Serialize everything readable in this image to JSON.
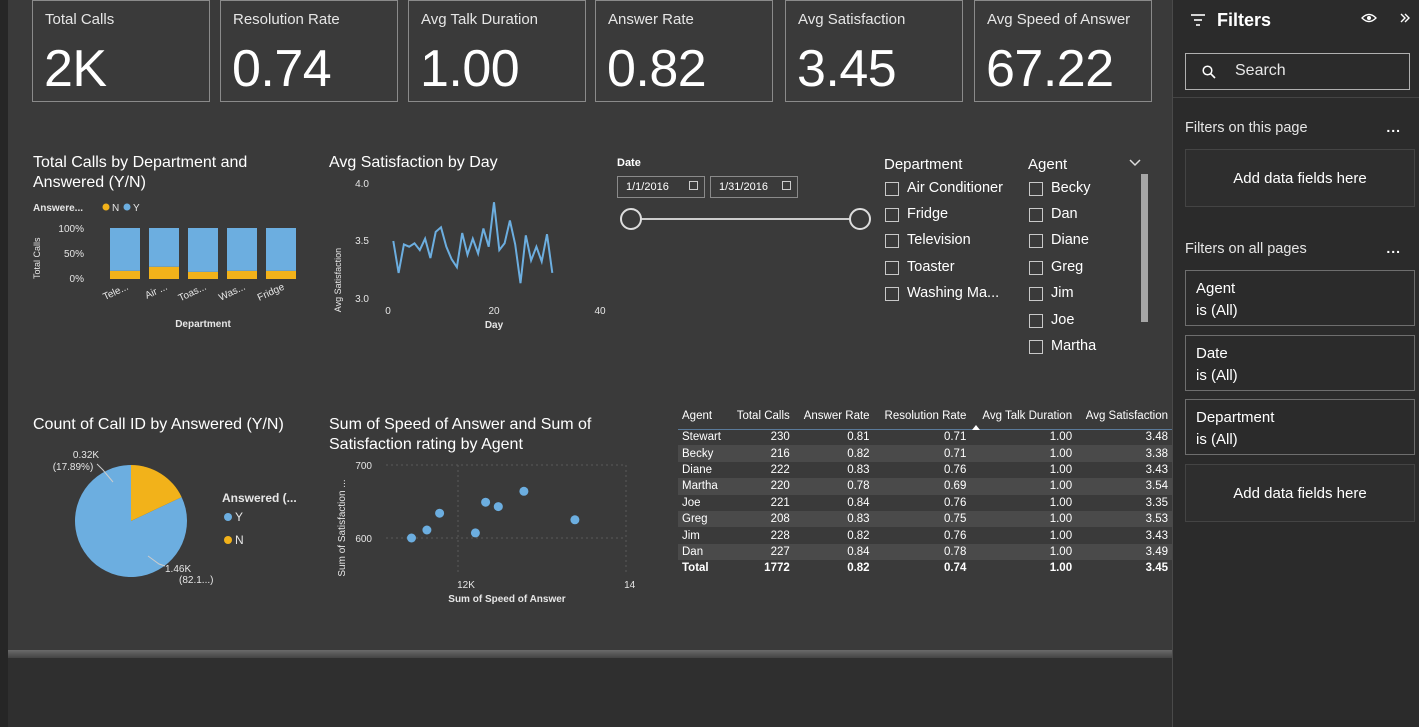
{
  "kpis": [
    {
      "label": "Total Calls",
      "value": "2K"
    },
    {
      "label": "Resolution Rate",
      "value": "0.74"
    },
    {
      "label": "Avg Talk Duration",
      "value": "1.00"
    },
    {
      "label": "Answer Rate",
      "value": "0.82"
    },
    {
      "label": "Avg Satisfaction",
      "value": "3.45"
    },
    {
      "label": "Avg Speed of Answer",
      "value": "67.22"
    }
  ],
  "charts": {
    "dept": {
      "title": "Total Calls by Department and Answered (Y/N)",
      "legend_label": "Answere...",
      "legend_n": "N",
      "legend_y": "Y",
      "ylabel": "Total Calls",
      "xlabel": "Department",
      "ticks": [
        "100%",
        "50%",
        "0%"
      ],
      "categories": [
        "Tele...",
        "Air ...",
        "Toas...",
        "Was...",
        "Fridge"
      ]
    },
    "day": {
      "title": "Avg Satisfaction by Day",
      "ylabel": "Avg Satisfaction",
      "xlabel": "Day",
      "yticks": [
        "4.0",
        "3.5",
        "3.0"
      ],
      "xticks": [
        "0",
        "20",
        "40"
      ]
    },
    "pie": {
      "title": "Count of Call ID by Answered (Y/N)",
      "label_n_value": "0.32K",
      "label_n_pct": "(17.89%)",
      "label_y_value": "1.46K",
      "label_y_pct": "(82.1...)",
      "legend_title": "Answered (...",
      "legend_y": "Y",
      "legend_n": "N"
    },
    "scatter": {
      "title_line1": "Sum of Speed of Answer and Sum of",
      "title_line2": "Satisfaction rating by Agent",
      "ylabel": "Sum of Satisfaction ...",
      "xlabel": "Sum of Speed of Answer",
      "yticks": [
        "700",
        "600"
      ],
      "xticks": [
        "12K",
        "14K"
      ]
    }
  },
  "chart_data": [
    {
      "type": "bar",
      "title": "Total Calls by Department and Answered (Y/N)",
      "xlabel": "Department",
      "ylabel": "Total Calls",
      "categories": [
        "Tele...",
        "Air ...",
        "Toas...",
        "Was...",
        "Fridge"
      ],
      "stacked_percent": true,
      "ylim": [
        0,
        100
      ],
      "series": [
        {
          "name": "N",
          "values": [
            16,
            24,
            14,
            16,
            16
          ]
        },
        {
          "name": "Y",
          "values": [
            84,
            76,
            86,
            84,
            84
          ]
        }
      ],
      "legend": "top-left",
      "colors": {
        "N": "#F2B21A",
        "Y": "#6CAEE0"
      }
    },
    {
      "type": "line",
      "title": "Avg Satisfaction by Day",
      "xlabel": "Day",
      "ylabel": "Avg Satisfaction",
      "xlim": [
        0,
        40
      ],
      "ylim": [
        3.0,
        4.0
      ],
      "series": [
        {
          "x": [
            1,
            2,
            3,
            4,
            5,
            6,
            7,
            8,
            9,
            10,
            11,
            12,
            13,
            14,
            15,
            16,
            17,
            18,
            19,
            20,
            21,
            22,
            23,
            24,
            25,
            26,
            27,
            28,
            29,
            30,
            31
          ],
          "values": [
            3.5,
            3.22,
            3.47,
            3.45,
            3.48,
            3.42,
            3.52,
            3.35,
            3.58,
            3.62,
            3.45,
            3.34,
            3.27,
            3.57,
            3.38,
            3.52,
            3.39,
            3.61,
            3.45,
            3.84,
            3.42,
            3.48,
            3.68,
            3.47,
            3.13,
            3.55,
            3.33,
            3.45,
            3.32,
            3.56,
            3.22
          ]
        }
      ],
      "color": "#6CAEE0"
    },
    {
      "type": "pie",
      "title": "Count of Call ID by Answered (Y/N)",
      "slices": [
        {
          "name": "Y",
          "value": 1.46,
          "percent": 82.11
        },
        {
          "name": "N",
          "value": 0.32,
          "percent": 17.89
        }
      ],
      "colors": {
        "Y": "#6CAEE0",
        "N": "#F2B21A"
      },
      "legend": "right"
    },
    {
      "type": "scatter",
      "title": "Sum of Speed of Answer and Sum of Satisfaction rating by Agent",
      "xlabel": "Sum of Speed of Answer",
      "ylabel": "Sum of Satisfaction ...",
      "xlim": [
        10000,
        14700
      ],
      "ylim": [
        560,
        700
      ],
      "points": [
        {
          "x": 10500,
          "y": 600
        },
        {
          "x": 10800,
          "y": 611
        },
        {
          "x": 11050,
          "y": 634
        },
        {
          "x": 11750,
          "y": 607
        },
        {
          "x": 11950,
          "y": 649
        },
        {
          "x": 12200,
          "y": 643
        },
        {
          "x": 12700,
          "y": 664
        },
        {
          "x": 13700,
          "y": 625
        }
      ],
      "color": "#6CAEE0"
    }
  ],
  "date_slicer": {
    "label": "Date",
    "start": "1/1/2016",
    "end": "1/31/2016"
  },
  "department_slicer": {
    "title": "Department",
    "items": [
      "Air Conditioner",
      "Fridge",
      "Television",
      "Toaster",
      "Washing Ma..."
    ]
  },
  "agent_slicer": {
    "title": "Agent",
    "items": [
      "Becky",
      "Dan",
      "Diane",
      "Greg",
      "Jim",
      "Joe",
      "Martha"
    ]
  },
  "table": {
    "headers": [
      "Agent",
      "Total Calls",
      "Answer Rate",
      "Resolution Rate",
      "Avg Talk Duration",
      "Avg Satisfaction"
    ],
    "rows": [
      [
        "Stewart",
        "230",
        "0.81",
        "0.71",
        "1.00",
        "3.48"
      ],
      [
        "Becky",
        "216",
        "0.82",
        "0.71",
        "1.00",
        "3.38"
      ],
      [
        "Diane",
        "222",
        "0.83",
        "0.76",
        "1.00",
        "3.43"
      ],
      [
        "Martha",
        "220",
        "0.78",
        "0.69",
        "1.00",
        "3.54"
      ],
      [
        "Joe",
        "221",
        "0.84",
        "0.76",
        "1.00",
        "3.35"
      ],
      [
        "Greg",
        "208",
        "0.83",
        "0.75",
        "1.00",
        "3.53"
      ],
      [
        "Jim",
        "228",
        "0.82",
        "0.76",
        "1.00",
        "3.43"
      ],
      [
        "Dan",
        "227",
        "0.84",
        "0.78",
        "1.00",
        "3.49"
      ]
    ],
    "total": [
      "Total",
      "1772",
      "0.82",
      "0.74",
      "1.00",
      "3.45"
    ]
  },
  "filters_pane": {
    "title": "Filters",
    "search_placeholder": "Search",
    "on_this_page": "Filters on this page",
    "on_all_pages": "Filters on all pages",
    "add_fields": "Add data fields here",
    "more": "...",
    "cards": [
      {
        "field": "Agent",
        "state": "is (All)"
      },
      {
        "field": "Date",
        "state": "is (All)"
      },
      {
        "field": "Department",
        "state": "is (All)"
      }
    ]
  },
  "colors": {
    "accent_blue": "#6CAEE0",
    "accent_yellow": "#F2B21A",
    "canvas": "#3a3a3a",
    "pane": "#2b2b2b"
  }
}
